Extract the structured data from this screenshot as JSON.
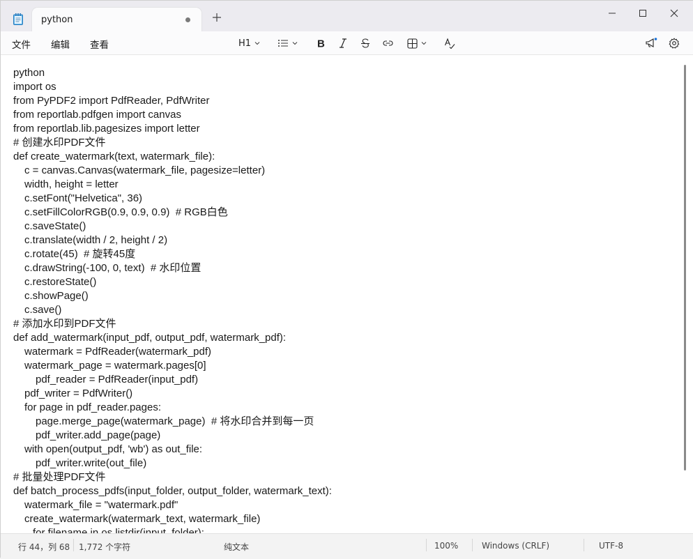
{
  "tab": {
    "title": "python"
  },
  "menu": {
    "file": "文件",
    "edit": "编辑",
    "view": "查看"
  },
  "toolbar": {
    "heading": "H1"
  },
  "editor": {
    "lines": [
      {
        "text": "python",
        "indent": 0
      },
      {
        "text": "import os",
        "indent": 0
      },
      {
        "text": "from PyPDF2 import PdfReader, PdfWriter",
        "indent": 0
      },
      {
        "text": "from reportlab.pdfgen import canvas",
        "indent": 0
      },
      {
        "text": "from reportlab.lib.pagesizes import letter",
        "indent": 0
      },
      {
        "text": "# 创建水印PDF文件",
        "indent": 0
      },
      {
        "text": "def create_watermark(text, watermark_file):",
        "indent": 0
      },
      {
        "text": "c = canvas.Canvas(watermark_file, pagesize=letter)",
        "indent": 1
      },
      {
        "text": "width, height = letter",
        "indent": 1
      },
      {
        "text": "c.setFont(\"Helvetica\", 36)",
        "indent": 1
      },
      {
        "text": "c.setFillColorRGB(0.9, 0.9, 0.9)  # RGB白色",
        "indent": 1
      },
      {
        "text": "c.saveState()",
        "indent": 1
      },
      {
        "text": "c.translate(width / 2, height / 2)",
        "indent": 1
      },
      {
        "text": "c.rotate(45)  # 旋转45度",
        "indent": 1
      },
      {
        "text": "c.drawString(-100, 0, text)  # 水印位置",
        "indent": 1
      },
      {
        "text": "c.restoreState()",
        "indent": 1
      },
      {
        "text": "c.showPage()",
        "indent": 1
      },
      {
        "text": "c.save()",
        "indent": 1
      },
      {
        "text": "# 添加水印到PDF文件",
        "indent": 0
      },
      {
        "text": "def add_watermark(input_pdf, output_pdf, watermark_pdf):",
        "indent": 0
      },
      {
        "text": "watermark = PdfReader(watermark_pdf)",
        "indent": 1
      },
      {
        "text": "watermark_page = watermark.pages[0]",
        "indent": 1
      },
      {
        "text": "pdf_reader = PdfReader(input_pdf)",
        "indent": 2
      },
      {
        "text": "pdf_writer = PdfWriter()",
        "indent": 1
      },
      {
        "text": "for page in pdf_reader.pages:",
        "indent": 1
      },
      {
        "text": "page.merge_page(watermark_page)  # 将水印合并到每一页",
        "indent": 2
      },
      {
        "text": "pdf_writer.add_page(page)",
        "indent": 2
      },
      {
        "text": "with open(output_pdf, 'wb') as out_file:",
        "indent": 1
      },
      {
        "text": "pdf_writer.write(out_file)",
        "indent": 2
      },
      {
        "text": "# 批量处理PDF文件",
        "indent": 0
      },
      {
        "text": "def batch_process_pdfs(input_folder, output_folder, watermark_text):",
        "indent": 0
      },
      {
        "text": "watermark_file = \"watermark.pdf\"",
        "indent": 1
      },
      {
        "text": "create_watermark(watermark_text, watermark_file)",
        "indent": 1
      },
      {
        "text": "for filename in os.listdir(input_folder):",
        "indent": 3
      }
    ]
  },
  "status": {
    "position": "行 44，列 68",
    "char_count": "1,772 个字符",
    "format": "纯文本",
    "zoom": "100%",
    "line_ending": "Windows (CRLF)",
    "encoding": "UTF-8"
  }
}
